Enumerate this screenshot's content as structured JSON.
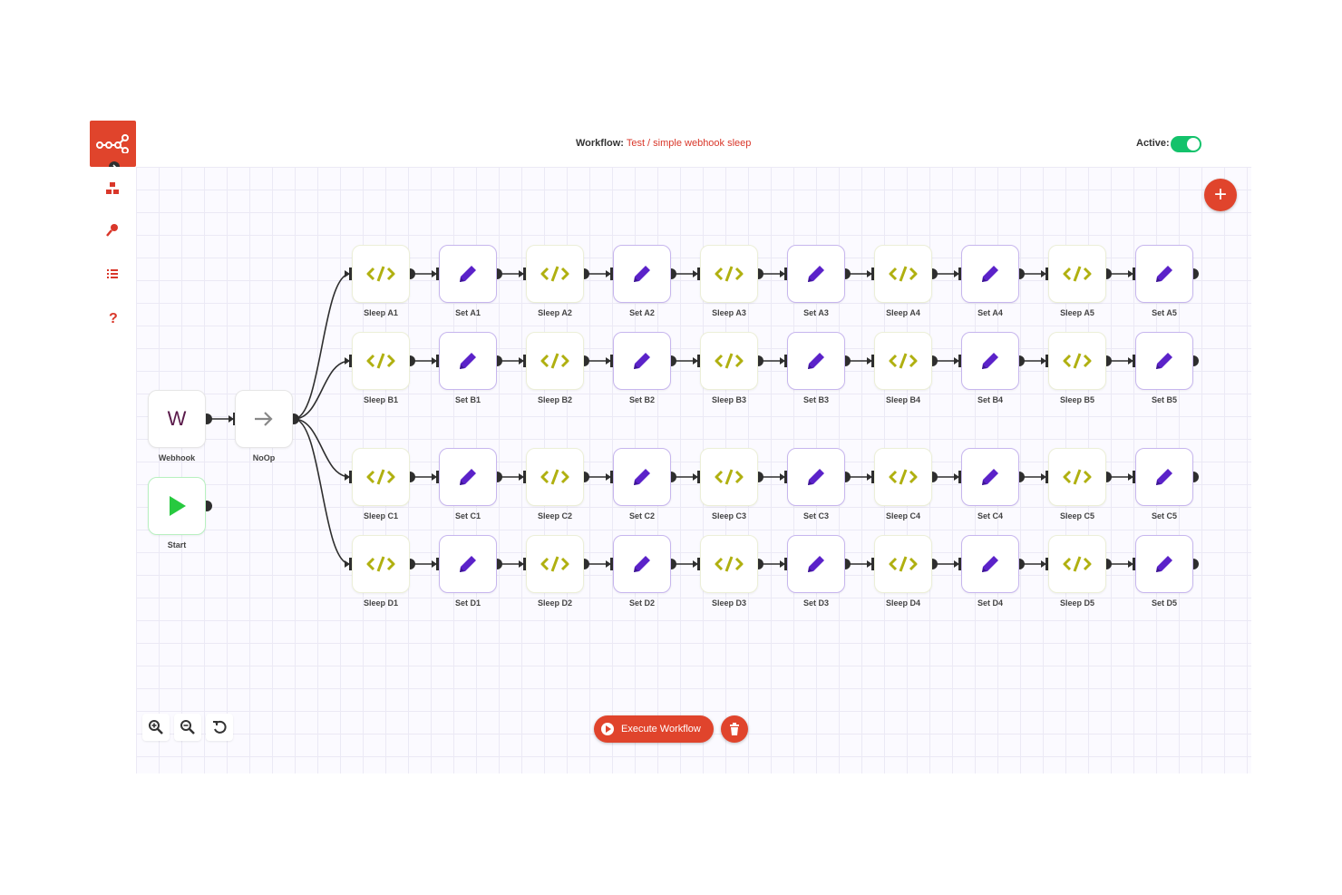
{
  "app": {
    "title_label": "Workflow:",
    "workflow_name": "Test / simple webhook sleep",
    "active_label": "Active:",
    "active": true
  },
  "colors": {
    "brand": "#e0442c",
    "toggle_on": "#13c26b",
    "code_icon": "#b0b010",
    "set_icon": "#5b22c9",
    "play_icon": "#27c93f"
  },
  "sidebar": {
    "items": [
      {
        "name": "nodes-icon"
      },
      {
        "name": "key-icon"
      },
      {
        "name": "list-icon"
      },
      {
        "name": "help-icon"
      }
    ]
  },
  "nodes": {
    "webhook": {
      "label": "Webhook",
      "icon_text": "W"
    },
    "noop": {
      "label": "NoOp"
    },
    "start": {
      "label": "Start"
    },
    "rows": [
      [
        "Sleep A1",
        "Set A1",
        "Sleep A2",
        "Set A2",
        "Sleep A3",
        "Set A3",
        "Sleep A4",
        "Set A4",
        "Sleep A5",
        "Set A5"
      ],
      [
        "Sleep B1",
        "Set B1",
        "Sleep B2",
        "Set B2",
        "Sleep B3",
        "Set B3",
        "Sleep B4",
        "Set B4",
        "Sleep B5",
        "Set B5"
      ],
      [
        "Sleep C1",
        "Set C1",
        "Sleep C2",
        "Set C2",
        "Sleep C3",
        "Set C3",
        "Sleep C4",
        "Set C4",
        "Sleep C5",
        "Set C5"
      ],
      [
        "Sleep D1",
        "Set D1",
        "Sleep D2",
        "Set D2",
        "Sleep D3",
        "Set D3",
        "Sleep D4",
        "Set D4",
        "Sleep D5",
        "Set D5"
      ]
    ]
  },
  "controls": {
    "execute_label": "Execute Workflow",
    "zoom_in": "zoom-in-icon",
    "zoom_out": "zoom-out-icon",
    "reset": "reset-zoom-icon"
  }
}
